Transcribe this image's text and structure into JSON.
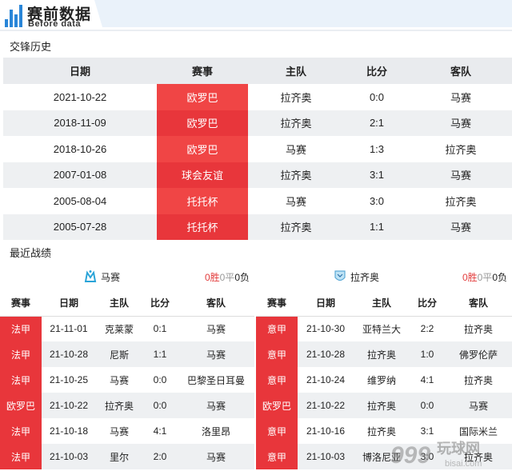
{
  "banner": {
    "title": "赛前数据",
    "subtitle": "Before data"
  },
  "h2h": {
    "section_title": "交锋历史",
    "headers": [
      "日期",
      "赛事",
      "主队",
      "比分",
      "客队"
    ],
    "rows": [
      [
        "2021-10-22",
        "欧罗巴",
        "拉齐奥",
        "0:0",
        "马赛"
      ],
      [
        "2018-11-09",
        "欧罗巴",
        "拉齐奥",
        "2:1",
        "马赛"
      ],
      [
        "2018-10-26",
        "欧罗巴",
        "马赛",
        "1:3",
        "拉齐奥"
      ],
      [
        "2007-01-08",
        "球会友谊",
        "拉齐奥",
        "3:1",
        "马赛"
      ],
      [
        "2005-08-04",
        "托托杯",
        "马赛",
        "3:0",
        "拉齐奥"
      ],
      [
        "2005-07-28",
        "托托杯",
        "拉齐奥",
        "1:1",
        "马赛"
      ]
    ]
  },
  "recent": {
    "section_title": "最近战绩",
    "headers": [
      "赛事",
      "日期",
      "主队",
      "比分",
      "客队"
    ],
    "left": {
      "team": "马赛",
      "logo_icon": "marseille-logo-icon",
      "record": {
        "w": "0胜",
        "d": "0平",
        "l": "0负"
      },
      "rows": [
        [
          "法甲",
          "21-11-01",
          "克莱蒙",
          "0:1",
          "马赛"
        ],
        [
          "法甲",
          "21-10-28",
          "尼斯",
          "1:1",
          "马赛"
        ],
        [
          "法甲",
          "21-10-25",
          "马赛",
          "0:0",
          "巴黎圣日耳曼"
        ],
        [
          "欧罗巴",
          "21-10-22",
          "拉齐奥",
          "0:0",
          "马赛"
        ],
        [
          "法甲",
          "21-10-18",
          "马赛",
          "4:1",
          "洛里昂"
        ],
        [
          "法甲",
          "21-10-03",
          "里尔",
          "2:0",
          "马赛"
        ]
      ]
    },
    "right": {
      "team": "拉齐奥",
      "logo_icon": "lazio-logo-icon",
      "record": {
        "w": "0胜",
        "d": "0平",
        "l": "0负"
      },
      "rows": [
        [
          "意甲",
          "21-10-30",
          "亚特兰大",
          "2:2",
          "拉齐奥"
        ],
        [
          "意甲",
          "21-10-28",
          "拉齐奥",
          "1:0",
          "佛罗伦萨"
        ],
        [
          "意甲",
          "21-10-24",
          "维罗纳",
          "4:1",
          "拉齐奥"
        ],
        [
          "欧罗巴",
          "21-10-22",
          "拉齐奥",
          "0:0",
          "马赛"
        ],
        [
          "意甲",
          "21-10-16",
          "拉齐奥",
          "3:1",
          "国际米兰"
        ],
        [
          "意甲",
          "21-10-03",
          "博洛尼亚",
          "3:0",
          "拉齐奥"
        ]
      ]
    }
  },
  "watermark": {
    "brand": "玩球网",
    "digits": "999",
    "url": "bisai.com"
  },
  "colors": {
    "accent_red": "#e8363b",
    "header_gray": "#e9ebee",
    "brand_blue": "#2a86d8"
  }
}
